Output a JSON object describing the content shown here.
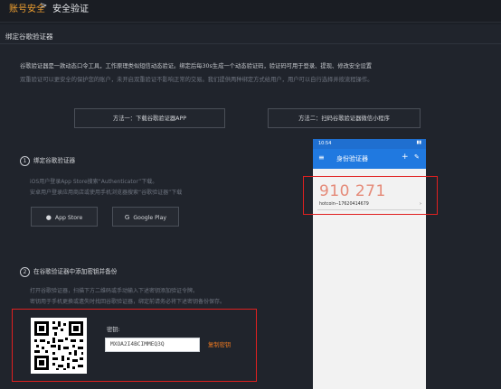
{
  "breadcrumb": {
    "root": "账号安全",
    "separator": ">",
    "current": "安全验证"
  },
  "panel": {
    "title": "绑定谷歌验证器",
    "desc_line1": "谷歌验证器是一款动态口令工具，工作原理类似短信动态验证。绑定后每30s生成一个动态验证码，验证码可用于登录、提现、修改安全设置",
    "desc_line2": "双重验证可以更安全的保护您的账户，未开启双重验证不影响正常的交易。我们提供两种绑定方式给用户，用户可以自行选择并按流程操作。",
    "method1": "方法一：下载谷歌验证器APP",
    "method2": "方法二：扫码谷歌验证器微信小程序"
  },
  "step1": {
    "num": "1",
    "title": "绑定谷歌验证器",
    "hint1": "iOS用户登录App Store搜索“Authenticator”下载。",
    "hint2": "安卓用户登录应用商店或使用手机浏览器搜索“谷歌验证器”下载",
    "app_store": "App Store",
    "google_play": "Google Play"
  },
  "step2": {
    "num": "2",
    "title": "在谷歌验证器中添加密钥并备份",
    "hint1": "打开谷歌验证器，扫描下方二维码或手动输入下述密钥添加验证令牌。",
    "hint2": "密钥用于手机更换或遗失时找回谷歌验证器，绑定前请务必将下述密钥备份保存。",
    "key_label": "密钥:",
    "key_value": "MXOA2I4BCIMMEQ3Q",
    "copy_label": "复制密钥"
  },
  "phone": {
    "time": "10:54",
    "app_title": "身份验证器",
    "code": "910 271",
    "account": "hotcoin--17620414679"
  },
  "colors": {
    "accent": "#f0a030",
    "highlight_red": "#e02020",
    "copy_orange": "#f07a20",
    "app_blue": "#2079e0",
    "code_color": "#e58a78"
  }
}
